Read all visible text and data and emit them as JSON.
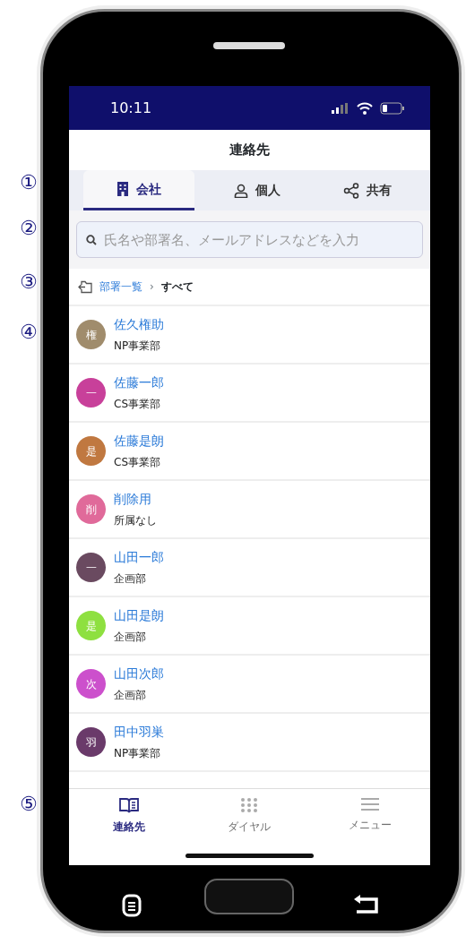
{
  "annotations": [
    "①",
    "②",
    "③",
    "④",
    "⑤"
  ],
  "status_bar": {
    "time": "10:11"
  },
  "header": {
    "title": "連絡先"
  },
  "tabs": [
    {
      "kind": "building",
      "label": "会社",
      "selected": true
    },
    {
      "kind": "person",
      "label": "個人",
      "selected": false
    },
    {
      "kind": "share",
      "label": "共有",
      "selected": false
    }
  ],
  "search": {
    "placeholder": "氏名や部署名、メールアドレスなどを入力"
  },
  "breadcrumb": {
    "link": "部署一覧",
    "separator": "›",
    "current": "すべて"
  },
  "contacts": [
    {
      "initial": "権",
      "name": "佐久権助",
      "department": "NP事業部",
      "color": "#a08c6c"
    },
    {
      "initial": "一",
      "name": "佐藤一郎",
      "department": "CS事業部",
      "color": "#c8409a"
    },
    {
      "initial": "是",
      "name": "佐藤是朗",
      "department": "CS事業部",
      "color": "#c07840"
    },
    {
      "initial": "削",
      "name": "削除用",
      "department": "所属なし",
      "color": "#e06a9a"
    },
    {
      "initial": "一",
      "name": "山田一郎",
      "department": "企画部",
      "color": "#6a4a60"
    },
    {
      "initial": "是",
      "name": "山田是朗",
      "department": "企画部",
      "color": "#8ee040"
    },
    {
      "initial": "次",
      "name": "山田次郎",
      "department": "企画部",
      "color": "#cc50cc"
    },
    {
      "initial": "羽",
      "name": "田中羽巣",
      "department": "NP事業部",
      "color": "#6a3a6a"
    }
  ],
  "bottom_nav": [
    {
      "kind": "book",
      "label": "連絡先",
      "selected": true
    },
    {
      "kind": "dial",
      "label": "ダイヤル",
      "selected": false
    },
    {
      "kind": "menu",
      "label": "メニュー",
      "selected": false
    }
  ]
}
